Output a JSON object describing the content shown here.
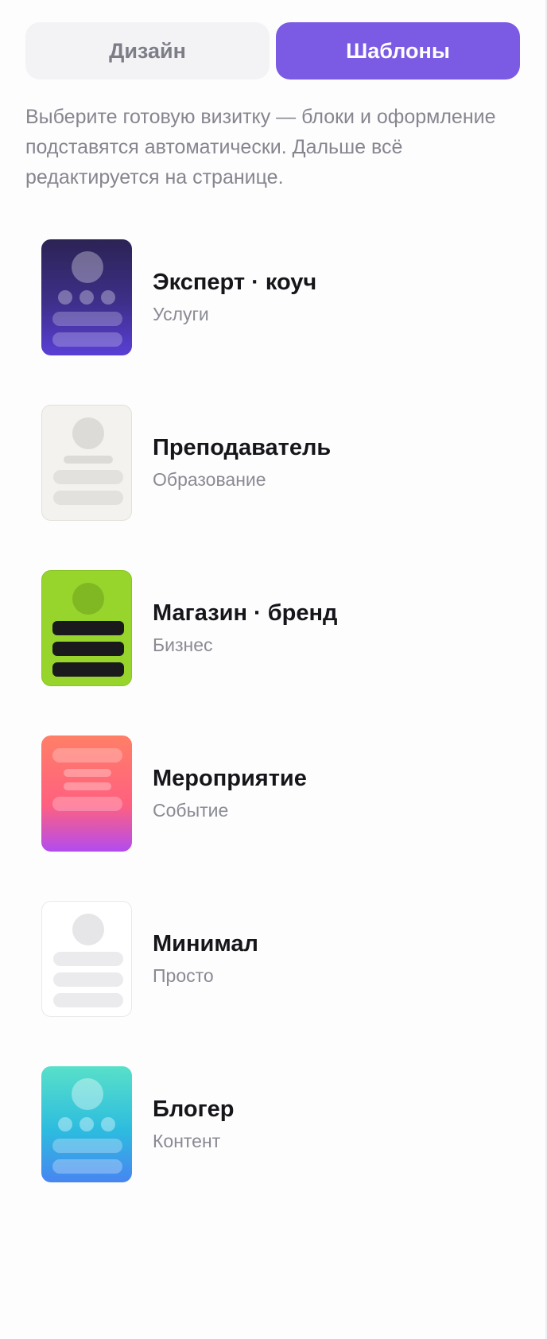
{
  "tabs": {
    "design_label": "Дизайн",
    "templates_label": "Шаблоны"
  },
  "intro": "Выберите готовую визитку — блоки и оформление подставятся автоматически. Дальше всё редактируется на странице.",
  "templates": [
    {
      "title": "Эксперт · коуч",
      "subtitle": "Услуги"
    },
    {
      "title": "Преподаватель",
      "subtitle": "Образование"
    },
    {
      "title": "Магазин · бренд",
      "subtitle": "Бизнес"
    },
    {
      "title": "Мероприятие",
      "subtitle": "Событие"
    },
    {
      "title": "Минимал",
      "subtitle": "Просто"
    },
    {
      "title": "Блогер",
      "subtitle": "Контент"
    }
  ],
  "colors": {
    "accent": "#7b5ae4",
    "inactive_tab_bg": "#f3f3f6",
    "muted_text": "#86868f"
  }
}
